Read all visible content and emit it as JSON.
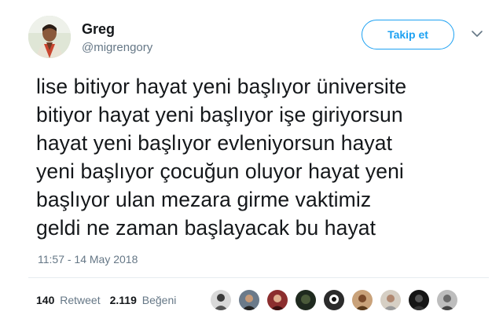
{
  "user": {
    "name": "Greg",
    "handle": "@migrengory"
  },
  "follow_button": {
    "label": "Takip et"
  },
  "tweet": {
    "lines": [
      "lise bitiyor hayat yeni başlıyor üniversite",
      "bitiyor hayat yeni başlıyor işe giriyorsun",
      "hayat yeni başlıyor evleniyorsun hayat",
      "yeni başlıyor çocuğun oluyor hayat yeni",
      "başlıyor ulan mezara girme vaktimiz",
      "geldi ne zaman başlayacak bu hayat"
    ],
    "timestamp": "11:57 - 14 May 2018"
  },
  "stats": {
    "retweets_count": "140",
    "retweets_label": "Retweet",
    "likes_count": "2.119",
    "likes_label": "Beğeni"
  },
  "icons": {
    "caret": "chevron-down-icon"
  },
  "colors": {
    "accent": "#1da1f2",
    "text": "#14171a",
    "secondary_text": "#657786",
    "divider": "#e6ecf0"
  }
}
